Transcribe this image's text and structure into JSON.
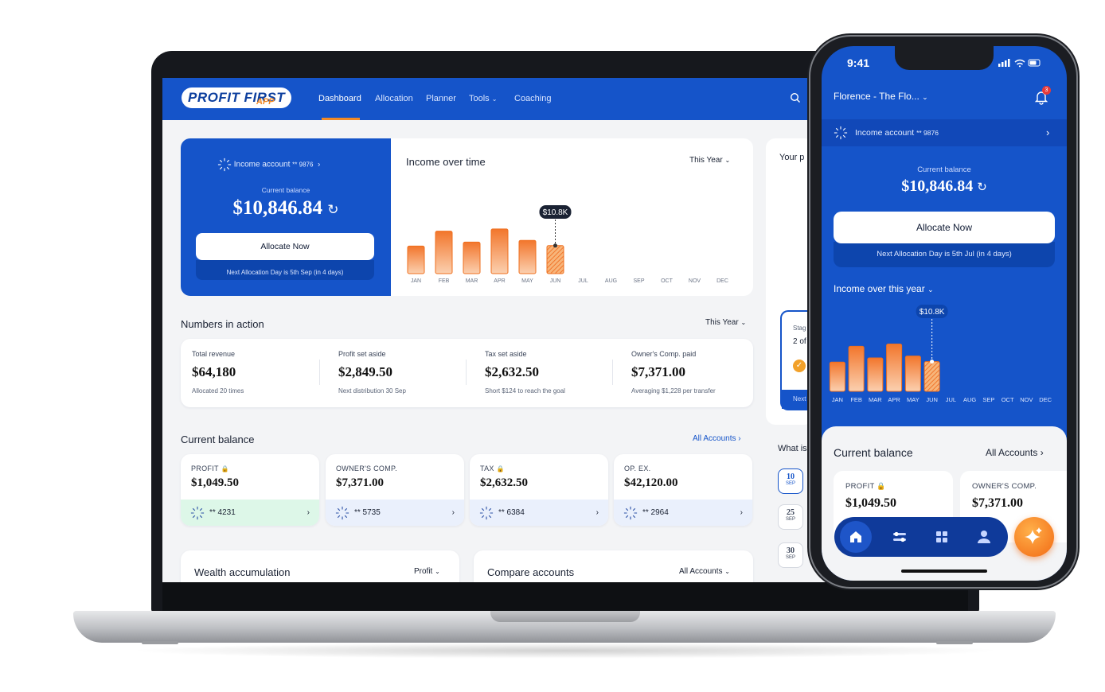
{
  "brand": {
    "logo_text": "PROFIT FIRST",
    "logo_app": "APP",
    "accent_blue": "#1554c9",
    "accent_orange": "#f28a26"
  },
  "nav": {
    "items": [
      "Dashboard",
      "Allocation",
      "Planner",
      "Tools",
      "Coaching"
    ],
    "active": "Dashboard"
  },
  "income_card": {
    "account_label": "Income account",
    "account_mask": "** 9876",
    "balance_label": "Current balance",
    "balance": "$10,846.84",
    "allocate_button": "Allocate Now",
    "next_allocation": "Next Allocation Day is 5th Sep (in 4 days)"
  },
  "income_chart": {
    "title": "Income over time",
    "period": "This Year",
    "tooltip": "$10.8K"
  },
  "chart_data": {
    "type": "bar",
    "categories": [
      "JAN",
      "FEB",
      "MAR",
      "APR",
      "MAY",
      "JUN",
      "JUL",
      "AUG",
      "SEP",
      "OCT",
      "NOV",
      "DEC"
    ],
    "values": [
      6.3,
      9.7,
      7.2,
      10.2,
      7.6,
      6.4,
      null,
      null,
      null,
      null,
      null,
      null
    ],
    "highlight": "JUN",
    "annotation": "$10.8K",
    "bar_color": "#f28a26",
    "ylim": [
      0,
      12
    ]
  },
  "numbers": {
    "title": "Numbers in action",
    "period": "This Year",
    "items": [
      {
        "label": "Total revenue",
        "value": "$64,180",
        "sub": "Allocated 20 times"
      },
      {
        "label": "Profit set aside",
        "value": "$2,849.50",
        "sub": "Next distribution 30 Sep"
      },
      {
        "label": "Tax set aside",
        "value": "$2,632.50",
        "sub": "Short $124 to reach the goal"
      },
      {
        "label": "Owner's Comp. paid",
        "value": "$7,371.00",
        "sub": "Averaging $1,228 per transfer"
      }
    ]
  },
  "balances": {
    "title": "Current balance",
    "link": "All Accounts",
    "accounts": [
      {
        "label": "PROFIT",
        "value": "$1,049.50",
        "mask": "** 4231",
        "locked": true,
        "footer_color": "#ddf7e8"
      },
      {
        "label": "OWNER'S COMP.",
        "value": "$7,371.00",
        "mask": "** 5735",
        "locked": false,
        "footer_color": "#eaf0fc"
      },
      {
        "label": "TAX",
        "value": "$2,632.50",
        "mask": "** 6384",
        "locked": true,
        "footer_color": "#eaf0fc"
      },
      {
        "label": "OP. EX.",
        "value": "$42,120.00",
        "mask": "** 2964",
        "locked": false,
        "footer_color": "#eaf0fc"
      }
    ]
  },
  "bottom_cards": {
    "wealth": {
      "title": "Wealth accumulation",
      "filter": "Profit"
    },
    "compare": {
      "title": "Compare accounts",
      "filter": "All Accounts"
    }
  },
  "side_peek": {
    "title": "Your p",
    "stage_label": "Stag",
    "stage_value": "2 of",
    "next_label": "Next",
    "what_label": "What is",
    "dates": [
      {
        "day": "10",
        "month": "SEP"
      },
      {
        "day": "25",
        "month": "SEP"
      },
      {
        "day": "30",
        "month": "SEP"
      }
    ]
  },
  "phone": {
    "time": "9:41",
    "business": "Florence - The Flo...",
    "notifications": "3",
    "account_label": "Income account",
    "account_mask": "** 9876",
    "balance_label": "Current balance",
    "balance": "$10,846.84",
    "allocate_button": "Allocate Now",
    "next_allocation": "Next Allocation Day is 5th Jul (in 4 days)",
    "chart_title": "Income over this year",
    "tooltip": "$10.8K",
    "balance_title": "Current balance",
    "all_accounts": "All Accounts",
    "accounts": [
      {
        "label": "PROFIT",
        "value": "$1,049.50"
      },
      {
        "label": "OWNER'S COMP.",
        "value": "$7,371.00"
      }
    ],
    "tabs": [
      "home-icon",
      "sliders-icon",
      "grid-icon",
      "profile-icon"
    ]
  }
}
